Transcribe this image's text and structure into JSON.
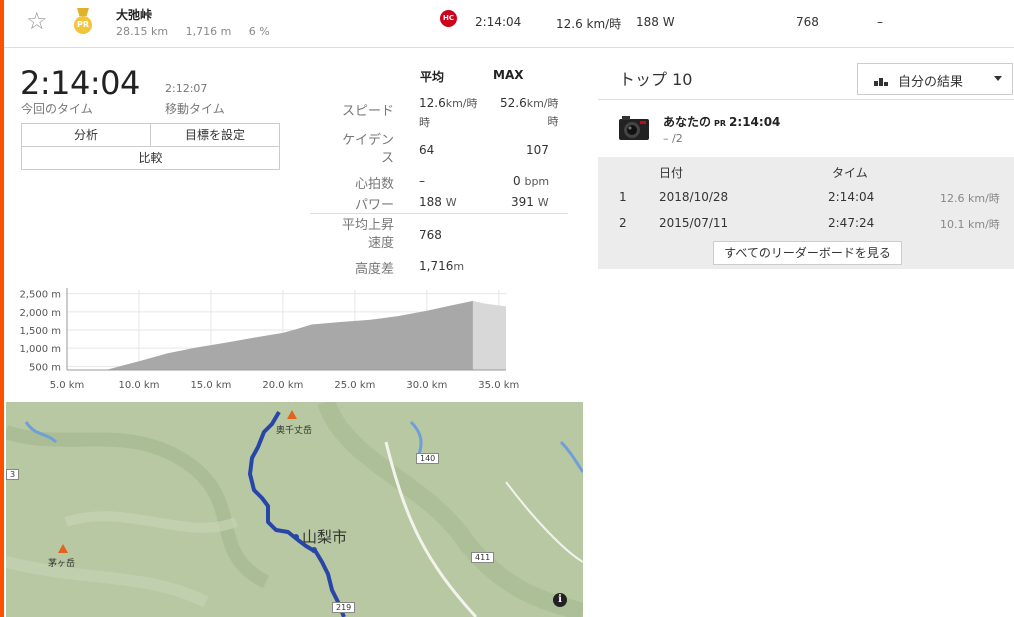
{
  "segment": {
    "name": "大弛峠",
    "distance": "28.15 km",
    "elevation": "1,716 m",
    "grade": "6 %",
    "pr_badge": "PR",
    "category_badge": "HC",
    "time": "2:14:04",
    "speed": "12.6 km/時",
    "power": "188 W",
    "vam": "768",
    "hr": "–",
    "icons": {
      "star": "star-icon",
      "medal": "pr-medal-icon",
      "category": "hc-icon"
    },
    "accent_color": "#fc5200"
  },
  "summary": {
    "elapsed_time": "2:14:04",
    "elapsed_label": "今回のタイム",
    "moving_time": "2:12:07",
    "moving_label": "移動タイム",
    "buttons": {
      "analysis": "分析",
      "set_goal": "目標を設定",
      "compare": "比較"
    }
  },
  "stats": {
    "col_avg": "平均",
    "col_max": "MAX",
    "rows": [
      {
        "label": "スピード",
        "avg": "12.6",
        "avg_unit": "km/時",
        "max": "52.6",
        "max_unit": "km/時"
      },
      {
        "label": "ケイデンス",
        "avg": "64",
        "avg_unit": "",
        "max": "107",
        "max_unit": ""
      },
      {
        "label": "心拍数",
        "avg": "–",
        "avg_unit": "",
        "max": "0",
        "max_unit": "bpm"
      },
      {
        "label": "パワー",
        "avg": "188",
        "avg_unit": "W",
        "max": "391",
        "max_unit": "W"
      }
    ],
    "vam_label": "平均上昇速度",
    "vam_value": "768",
    "elev_label": "高度差",
    "elev_value": "1,716",
    "elev_unit": "m"
  },
  "chart_data": {
    "type": "area",
    "title": "",
    "xlabel": "",
    "ylabel": "",
    "x_ticks": [
      "5.0 km",
      "10.0 km",
      "15.0 km",
      "20.0 km",
      "25.0 km",
      "30.0 km",
      "35.0 km"
    ],
    "y_ticks": [
      "500 m",
      "1,000 m",
      "1,500 m",
      "2,000 m",
      "2,500 m"
    ],
    "xlim": [
      5,
      35.5
    ],
    "ylim": [
      400,
      2600
    ],
    "segment_range_km": [
      7.7,
      33.2
    ],
    "x": [
      7.7,
      10,
      12,
      14,
      16,
      18,
      20,
      21,
      22,
      24,
      26,
      28,
      30,
      32,
      33.2,
      34,
      35.5
    ],
    "y": [
      400,
      640,
      860,
      1020,
      1150,
      1290,
      1420,
      1530,
      1650,
      1720,
      1780,
      1880,
      2030,
      2200,
      2300,
      2230,
      2150
    ],
    "grid": true,
    "colors": {
      "segment": "#a8a8a8",
      "outside": "#d8d8d8"
    }
  },
  "map": {
    "labels": {
      "peak1": "奥千丈岳",
      "peak2": "茅ヶ岳",
      "city": "山梨市",
      "road1": "140",
      "road2": "411",
      "road3": "219",
      "edge": "3"
    },
    "info_icon": "i",
    "route_color": "#2846a8"
  },
  "leaderboard": {
    "title": "トップ 10",
    "filter_label": "自分の結果",
    "you_label": "あなたの",
    "pr_tag": "PR",
    "you_time": "2:14:04",
    "you_rank": "– /2",
    "col_date": "日付",
    "col_time": "タイム",
    "rows": [
      {
        "rank": "1",
        "date": "2018/10/28",
        "time": "2:14:04",
        "speed": "12.6 km/時"
      },
      {
        "rank": "2",
        "date": "2015/07/11",
        "time": "2:47:24",
        "speed": "10.1 km/時"
      }
    ],
    "view_all": "すべてのリーダーボードを見る"
  }
}
